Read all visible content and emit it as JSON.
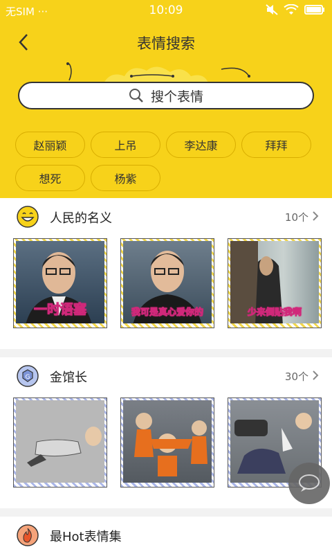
{
  "statusbar": {
    "carrier": "无SIM",
    "dots": "···",
    "time": "10:09"
  },
  "header": {
    "title": "表情搜索",
    "back_icon": "chevron-left-icon"
  },
  "search": {
    "placeholder": "搜个表情",
    "icon": "search-icon"
  },
  "tags": [
    "赵丽颖",
    "上吊",
    "李达康",
    "拜拜",
    "想死",
    "杨紫"
  ],
  "sections": [
    {
      "title": "人民的名义",
      "count": "10个",
      "icon": "smile-face-icon",
      "captions": [
        "一时语塞",
        "我可是真心爱你的",
        "少来倒贴我啊"
      ]
    },
    {
      "title": "金馆长",
      "count": "30个",
      "icon": "badge-icon"
    },
    {
      "title": "最Hot表情集",
      "icon": "flame-icon"
    }
  ],
  "colors": {
    "brand_yellow": "#f7d21a",
    "text": "#333333"
  }
}
